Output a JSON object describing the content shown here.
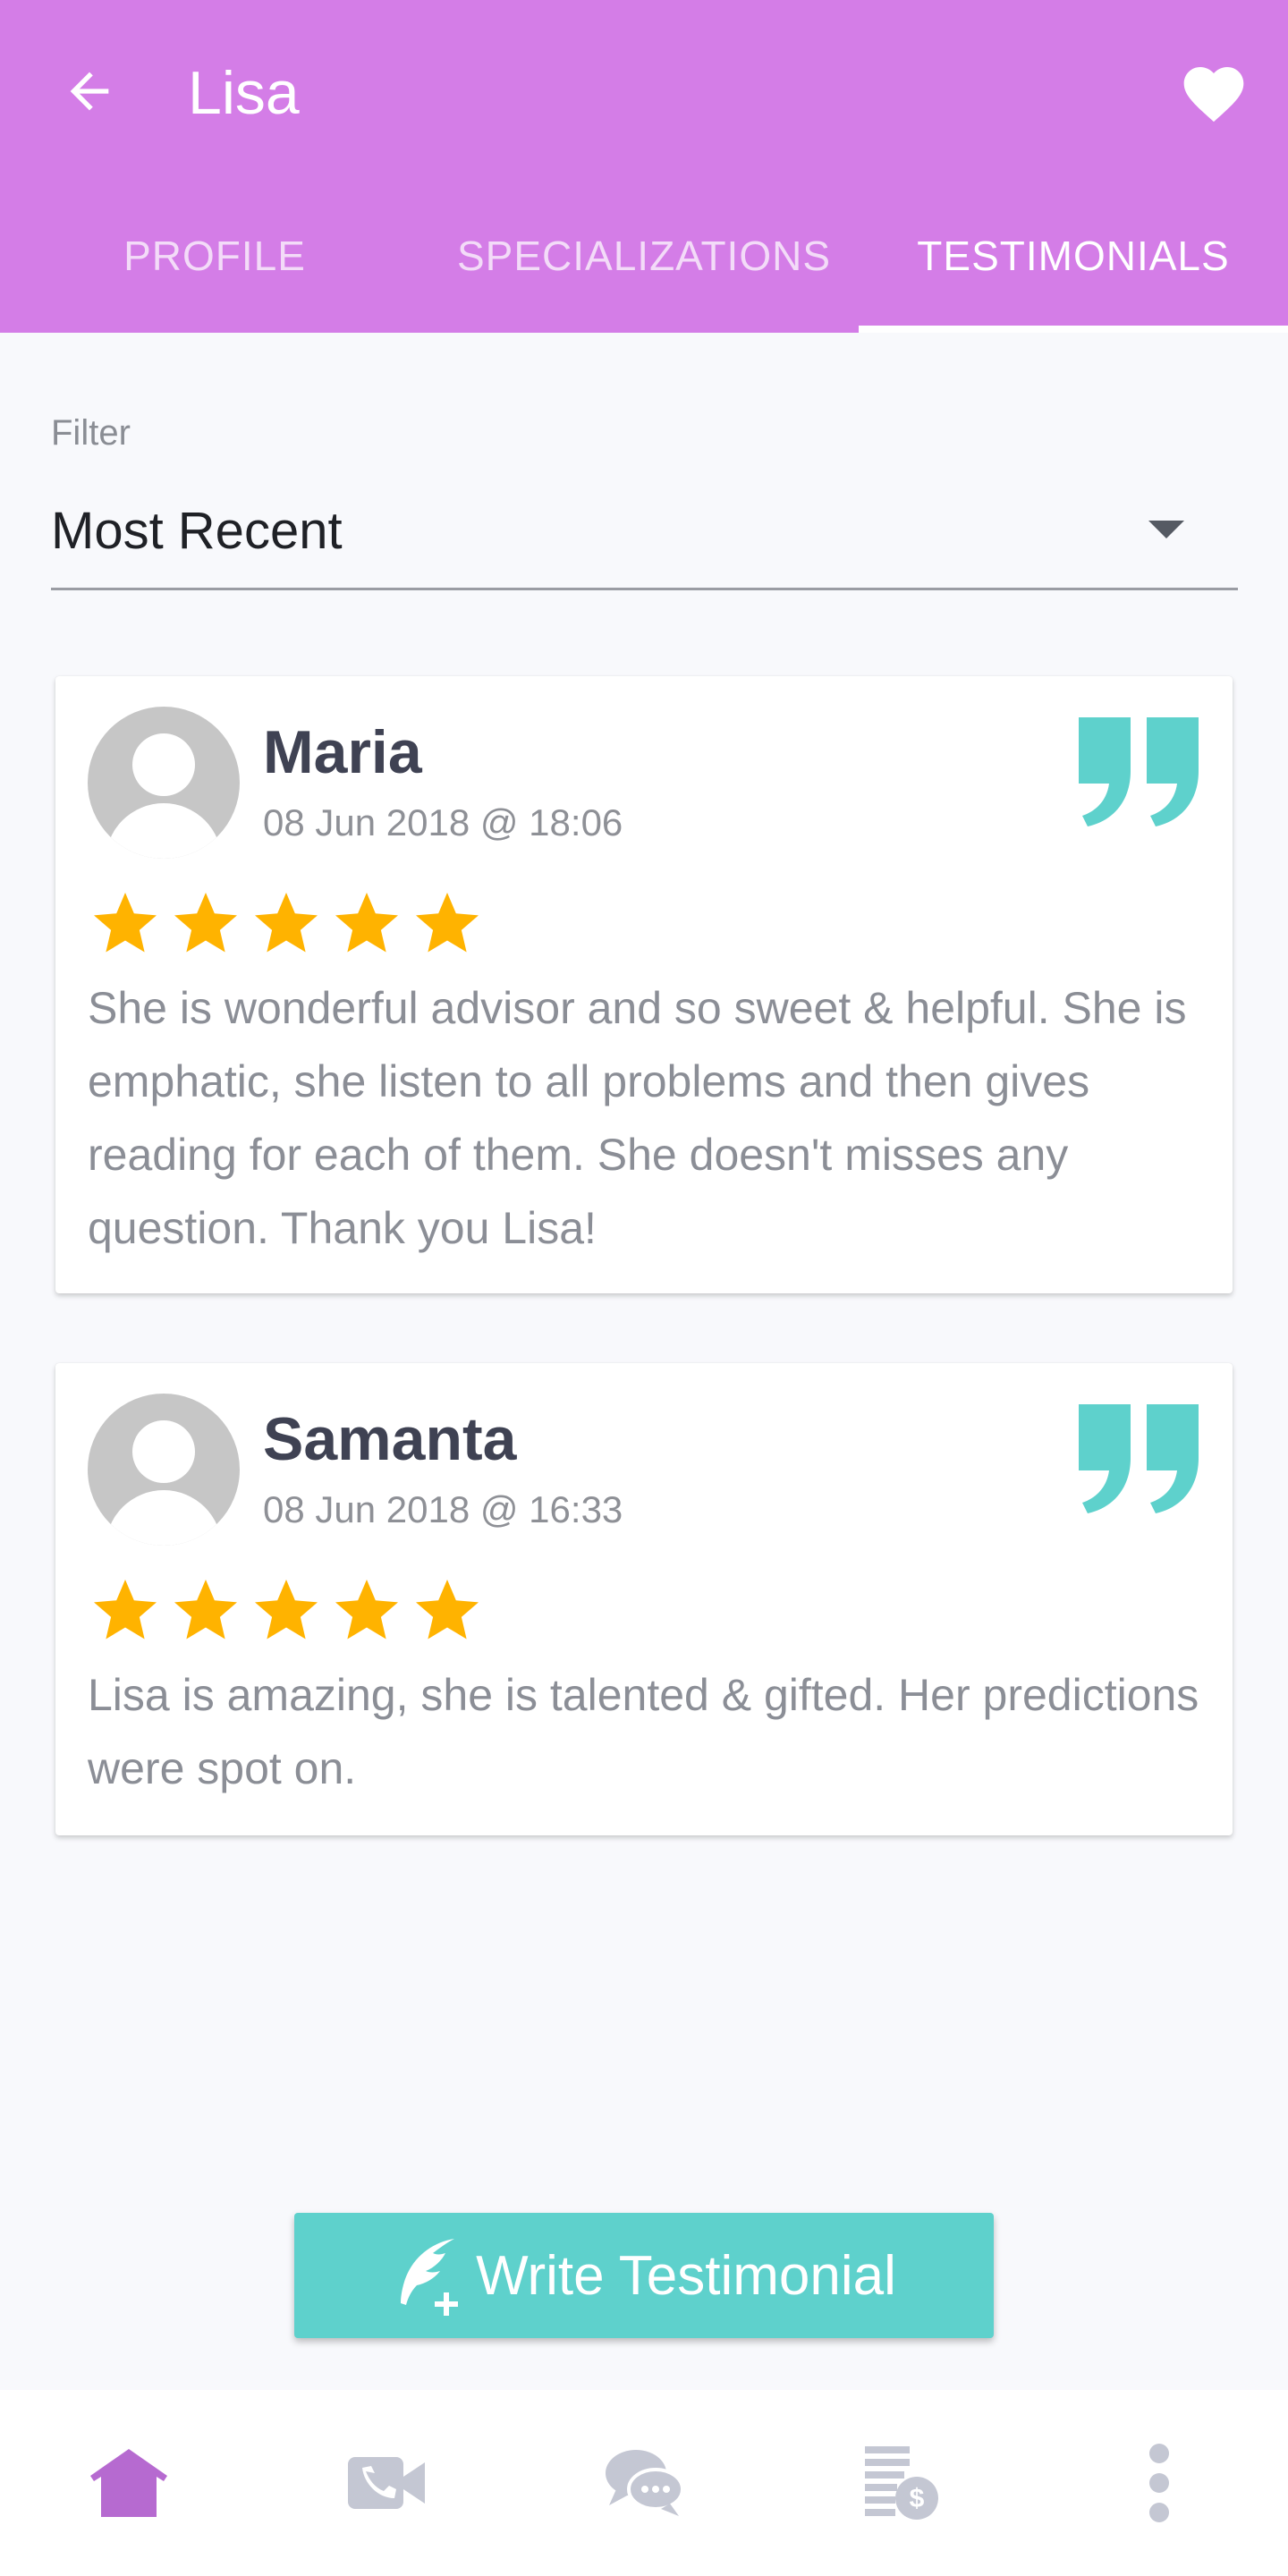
{
  "header": {
    "title": "Lisa",
    "back_icon": "arrow-left-icon",
    "favorite_icon": "heart-icon",
    "tabs": [
      {
        "label": "PROFILE",
        "active": false
      },
      {
        "label": "SPECIALIZATIONS",
        "active": false
      },
      {
        "label": "TESTIMONIALS",
        "active": true
      }
    ]
  },
  "filter": {
    "label": "Filter",
    "selected": "Most Recent"
  },
  "testimonials": [
    {
      "name": "Maria",
      "date": "08 Jun 2018 @ 18:06",
      "rating": 5,
      "text": "She is wonderful advisor and so sweet & helpful. She is emphatic, she listen to all problems and then gives reading for each of them. She doesn't misses any question. Thank you Lisa!"
    },
    {
      "name": "Samanta",
      "date": "08 Jun 2018 @ 16:33",
      "rating": 5,
      "text": "Lisa is amazing, she is talented & gifted. Her predictions were spot on."
    }
  ],
  "write_button": {
    "label": "Write Testimonial",
    "icon": "feather-plus-icon"
  },
  "bottom_nav": [
    {
      "icon": "home-icon",
      "active": true
    },
    {
      "icon": "video-call-icon",
      "active": false
    },
    {
      "icon": "chat-icon",
      "active": false
    },
    {
      "icon": "billing-icon",
      "active": false
    },
    {
      "icon": "more-icon",
      "active": false
    }
  ],
  "colors": {
    "header": "#d47de7",
    "accent": "#5ed1cc",
    "star": "#ffb300",
    "nav_active": "#b66ad0",
    "nav_inactive": "#c4c7d3"
  }
}
